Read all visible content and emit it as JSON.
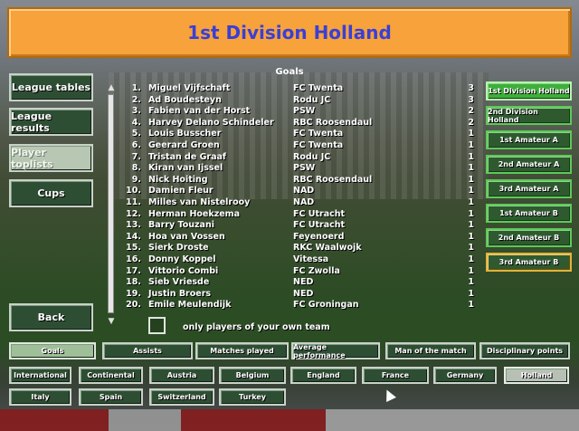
{
  "title": "1st Division Holland",
  "left_menu": [
    {
      "label": "League tables",
      "selected": false
    },
    {
      "label": "League results",
      "selected": false
    },
    {
      "label": "Player toplists",
      "selected": true
    },
    {
      "label": "Cups",
      "selected": false
    }
  ],
  "back_label": "Back",
  "list": {
    "title": "Goals",
    "rows": [
      {
        "rank": "1.",
        "name": "Miguel Vijfschaft",
        "club": "FC Twenta",
        "value": "3"
      },
      {
        "rank": "2.",
        "name": "Ad Boudesteyn",
        "club": "Rodu JC",
        "value": "3"
      },
      {
        "rank": "3.",
        "name": "Fabien van der Horst",
        "club": "PSW",
        "value": "2"
      },
      {
        "rank": "4.",
        "name": "Harvey Delano Schindeler",
        "club": "RBC Roosendaul",
        "value": "2"
      },
      {
        "rank": "5.",
        "name": "Louis Busscher",
        "club": "FC Twenta",
        "value": "1"
      },
      {
        "rank": "6.",
        "name": "Geerard Groen",
        "club": "FC Twenta",
        "value": "1"
      },
      {
        "rank": "7.",
        "name": "Tristan de Graaf",
        "club": "Rodu JC",
        "value": "1"
      },
      {
        "rank": "8.",
        "name": "Kiran van Ijssel",
        "club": "PSW",
        "value": "1"
      },
      {
        "rank": "9.",
        "name": "Nick Hoiting",
        "club": "RBC Roosendaul",
        "value": "1"
      },
      {
        "rank": "10.",
        "name": "Damien Fleur",
        "club": "NAD",
        "value": "1"
      },
      {
        "rank": "11.",
        "name": "Milles van Nistelrooy",
        "club": "NAD",
        "value": "1"
      },
      {
        "rank": "12.",
        "name": "Herman Hoekzema",
        "club": "FC Utracht",
        "value": "1"
      },
      {
        "rank": "13.",
        "name": "Barry Touzani",
        "club": "FC Utracht",
        "value": "1"
      },
      {
        "rank": "14.",
        "name": "Hoa van Vossen",
        "club": "Feyenoerd",
        "value": "1"
      },
      {
        "rank": "15.",
        "name": "Sierk Droste",
        "club": "RKC Waalwojk",
        "value": "1"
      },
      {
        "rank": "16.",
        "name": "Donny Koppel",
        "club": "Vitessa",
        "value": "1"
      },
      {
        "rank": "17.",
        "name": "Vittorio Combi",
        "club": "FC Zwolla",
        "value": "1"
      },
      {
        "rank": "18.",
        "name": "Sieb Vriesde",
        "club": "NED",
        "value": "1"
      },
      {
        "rank": "19.",
        "name": "Justin Broers",
        "club": "NED",
        "value": "1"
      },
      {
        "rank": "20.",
        "name": "Emile Meulendijk",
        "club": "FC Groningan",
        "value": "1"
      }
    ]
  },
  "own_team_label": "only players of your own team",
  "divisions": [
    {
      "label": "1st Division Holland",
      "selected": true
    },
    {
      "label": "2nd Division Holland",
      "selected": false
    },
    {
      "label": "1st Amateur A",
      "selected": false
    },
    {
      "label": "2nd Amateur A",
      "selected": false
    },
    {
      "label": "3rd Amateur A",
      "selected": false
    },
    {
      "label": "1st Amateur B",
      "selected": false
    },
    {
      "label": "2nd Amateur B",
      "selected": false
    },
    {
      "label": "3rd Amateur B",
      "selected": false
    }
  ],
  "categories": [
    {
      "label": "Goals",
      "selected": true
    },
    {
      "label": "Assists",
      "selected": false
    },
    {
      "label": "Matches played",
      "selected": false
    },
    {
      "label": "Average performance",
      "selected": false
    },
    {
      "label": "Man of the match",
      "selected": false
    },
    {
      "label": "Disciplinary points",
      "selected": false
    }
  ],
  "countries": [
    {
      "label": "International",
      "selected": false
    },
    {
      "label": "Continental",
      "selected": false
    },
    {
      "label": "Austria",
      "selected": false
    },
    {
      "label": "Belgium",
      "selected": false
    },
    {
      "label": "England",
      "selected": false
    },
    {
      "label": "France",
      "selected": false
    },
    {
      "label": "Germany",
      "selected": false
    },
    {
      "label": "Holland",
      "selected": true
    },
    {
      "label": "Italy",
      "selected": false
    },
    {
      "label": "Spain",
      "selected": false
    },
    {
      "label": "Switzerland",
      "selected": false
    },
    {
      "label": "Turkey",
      "selected": false
    }
  ],
  "colors": {
    "title_bg": "#f7a23a",
    "title_text": "#3a3fd6",
    "button_bg": "#2e4e34",
    "division_border": "#5ec85a",
    "division_selected": "#3fae3b"
  }
}
